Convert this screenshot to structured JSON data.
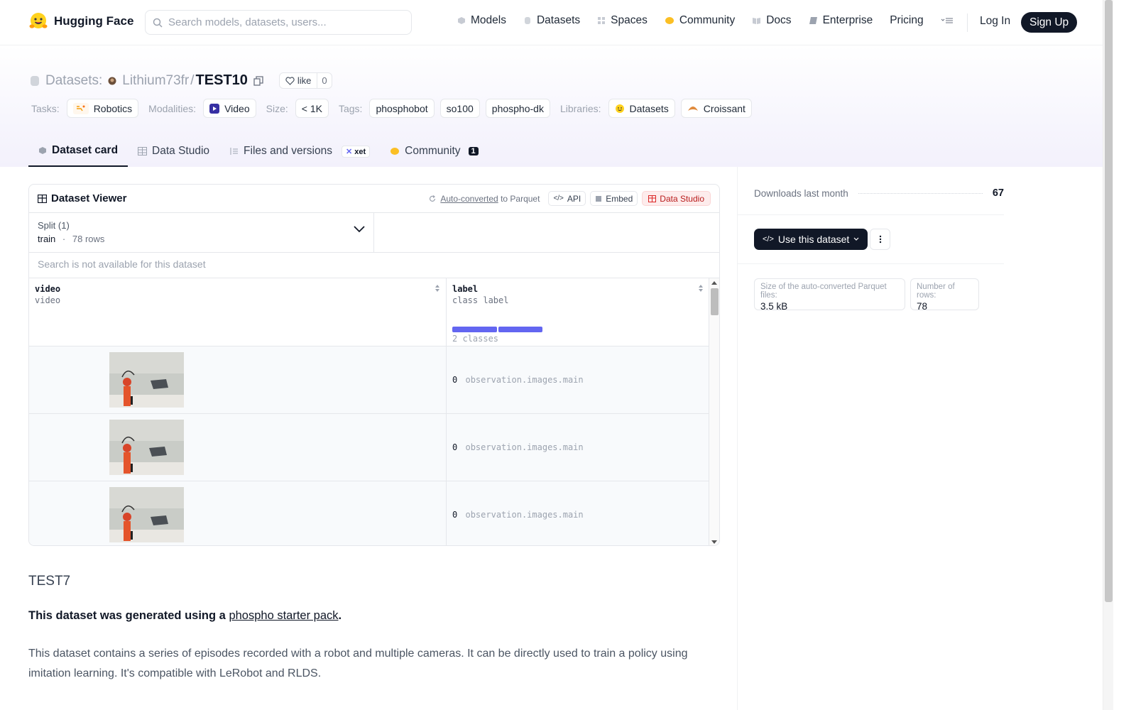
{
  "brand": {
    "name": "Hugging Face",
    "icon": "hugging-face-emoji"
  },
  "search": {
    "placeholder": "Search models, datasets, users..."
  },
  "nav": {
    "links": [
      {
        "label": "Models",
        "icon": "model-cube-icon"
      },
      {
        "label": "Datasets",
        "icon": "database-icon"
      },
      {
        "label": "Spaces",
        "icon": "spaces-grid-icon"
      },
      {
        "label": "Community",
        "icon": "community-icon"
      },
      {
        "label": "Docs",
        "icon": "book-icon"
      },
      {
        "label": "Enterprise",
        "icon": "enterprise-icon"
      },
      {
        "label": "Pricing"
      }
    ],
    "login": "Log In",
    "signup": "Sign Up"
  },
  "header": {
    "section": "Datasets:",
    "owner": "Lithium73fr",
    "separator": "/",
    "repo": "TEST10",
    "like_label": "like",
    "like_count": "0",
    "tasks_label": "Tasks:",
    "task": "Robotics",
    "modalities_label": "Modalities:",
    "modality": "Video",
    "size_label": "Size:",
    "size": "< 1K",
    "tags_label": "Tags:",
    "tags": [
      "phosphobot",
      "so100",
      "phospho-dk"
    ],
    "libraries_label": "Libraries:",
    "libraries": [
      "Datasets",
      "Croissant"
    ]
  },
  "tabs": [
    {
      "label": "Dataset card",
      "active": true
    },
    {
      "label": "Data Studio"
    },
    {
      "label": "Files and versions",
      "badge": "xet"
    },
    {
      "label": "Community",
      "badge": "1"
    }
  ],
  "viewer": {
    "title": "Dataset Viewer",
    "auto_converted": "Auto-converted",
    "to_parquet": "to Parquet",
    "api": "API",
    "embed": "Embed",
    "data_studio": "Data Studio",
    "split_label": "Split (1)",
    "split_value": "train",
    "split_sep": "·",
    "split_rows": "78 rows",
    "search_na": "Search is not available for this dataset",
    "columns": [
      {
        "name": "video",
        "type": "video"
      },
      {
        "name": "label",
        "type": "class label",
        "summary": "2 classes"
      }
    ],
    "rows": [
      {
        "label_id": "0",
        "label_name": "observation.images.main"
      },
      {
        "label_id": "0",
        "label_name": "observation.images.main"
      },
      {
        "label_id": "0",
        "label_name": "observation.images.main"
      }
    ]
  },
  "card": {
    "heading": "TEST7",
    "p1_before": "This dataset was generated using a",
    "p1_link": "phospho starter pack",
    "p1_after": ".",
    "p2": "This dataset contains a series of episodes recorded with a robot and multiple cameras. It can be directly used to train a policy using imitation learning. It's compatible with LeRobot and RLDS."
  },
  "sidebar": {
    "downloads_label": "Downloads last month",
    "downloads": "67",
    "use_dataset": "Use this dataset",
    "parquet_size_label": "Size of the auto-converted Parquet files:",
    "parquet_size": "3.5 kB",
    "num_rows_label": "Number of rows:",
    "num_rows": "78"
  },
  "colors": {
    "accent_dark": "#111827",
    "histogram": "#6366f1",
    "data_studio_red": "#b91c1c"
  }
}
